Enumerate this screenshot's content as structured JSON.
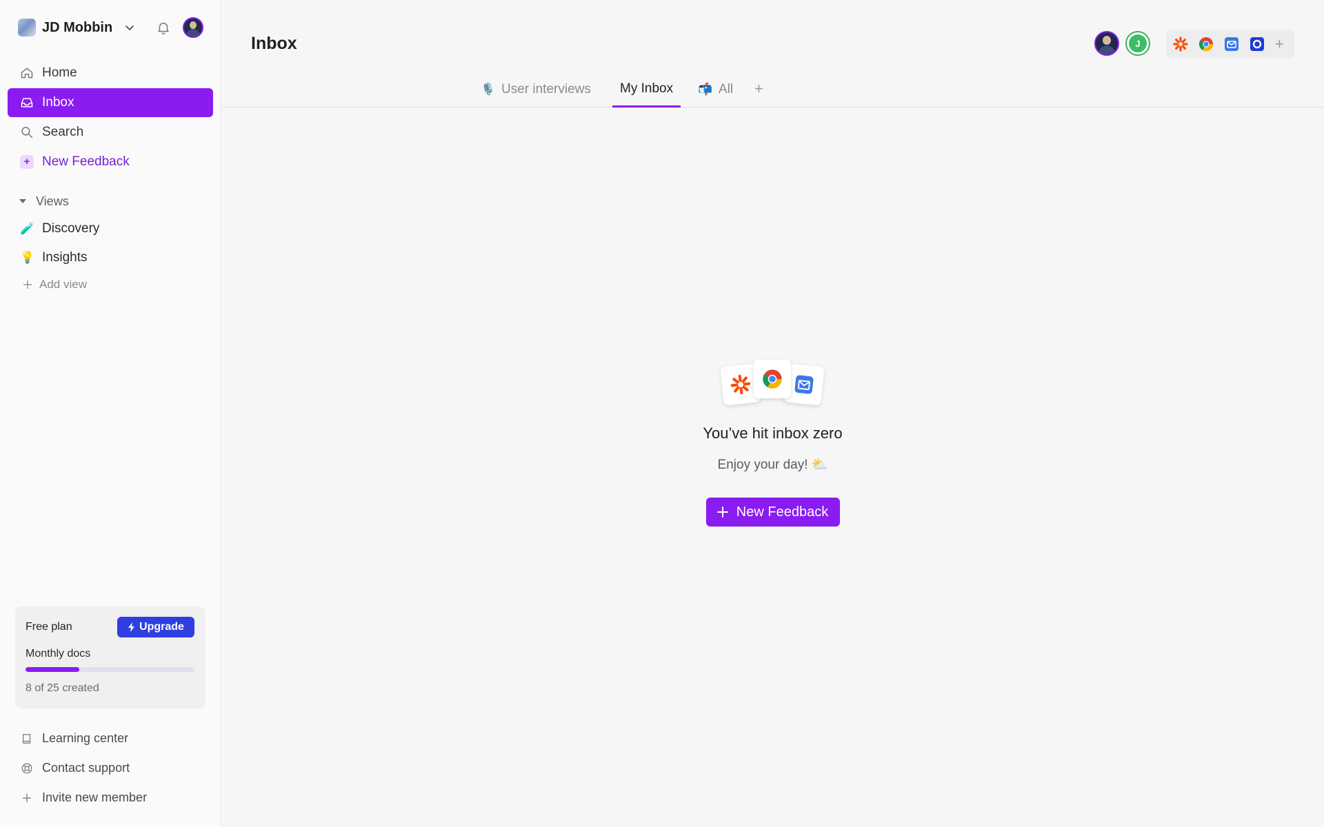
{
  "workspace": {
    "name": "JD Mobbin"
  },
  "nav": {
    "home": "Home",
    "inbox": "Inbox",
    "search": "Search",
    "new_feedback": "New Feedback"
  },
  "views": {
    "header": "Views",
    "discovery": {
      "emoji": "🧪",
      "label": "Discovery"
    },
    "insights": {
      "emoji": "💡",
      "label": "Insights"
    },
    "add": "Add view"
  },
  "plan": {
    "title": "Free plan",
    "upgrade": "Upgrade",
    "metric": "Monthly docs",
    "used": 8,
    "limit": 25,
    "count_text": "8 of 25 created"
  },
  "footer": {
    "learning": "Learning center",
    "support": "Contact support",
    "invite": "Invite new member"
  },
  "main": {
    "title": "Inbox",
    "collaborators": [
      {
        "initial": ""
      },
      {
        "initial": "J"
      }
    ],
    "integrations": [
      "zapier-icon",
      "chrome-icon",
      "mail-icon",
      "intercom-icon"
    ],
    "tabs": [
      {
        "emoji": "🎙️",
        "label": "User interviews",
        "active": false
      },
      {
        "emoji": "",
        "label": "My Inbox",
        "active": true
      },
      {
        "emoji": "📬",
        "label": "All",
        "active": false
      }
    ]
  },
  "empty": {
    "title": "You’ve hit inbox zero",
    "subtitle": "Enjoy your day! ⛅",
    "button": "New Feedback"
  },
  "colors": {
    "accent": "#8a1cf1",
    "upgrade": "#2f3ee0",
    "green": "#3dbc66"
  }
}
